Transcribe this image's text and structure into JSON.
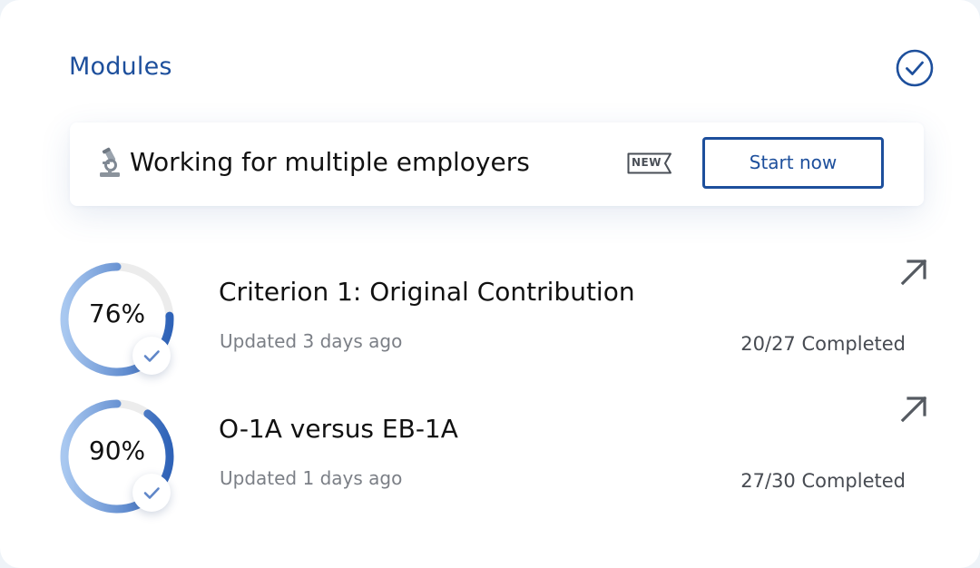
{
  "header": {
    "title": "Modules",
    "status_icon": "check-circle-icon",
    "accent_color": "#1d4f9c"
  },
  "banner": {
    "icon": "microscope-icon",
    "text": "Working for multiple employers",
    "badge": "NEW",
    "button_label": "Start now"
  },
  "modules": [
    {
      "percent_label": "76%",
      "progress": 0.76,
      "title": "Criterion 1: Original Contribution",
      "updated": "Updated 3 days ago",
      "completed": "20/27 Completed",
      "open_icon": "arrow-up-right-icon"
    },
    {
      "percent_label": "90%",
      "progress": 0.9,
      "title": "O-1A versus EB-1A",
      "updated": "Updated 1 days ago",
      "completed": "27/30 Completed",
      "open_icon": "arrow-up-right-icon"
    }
  ]
}
